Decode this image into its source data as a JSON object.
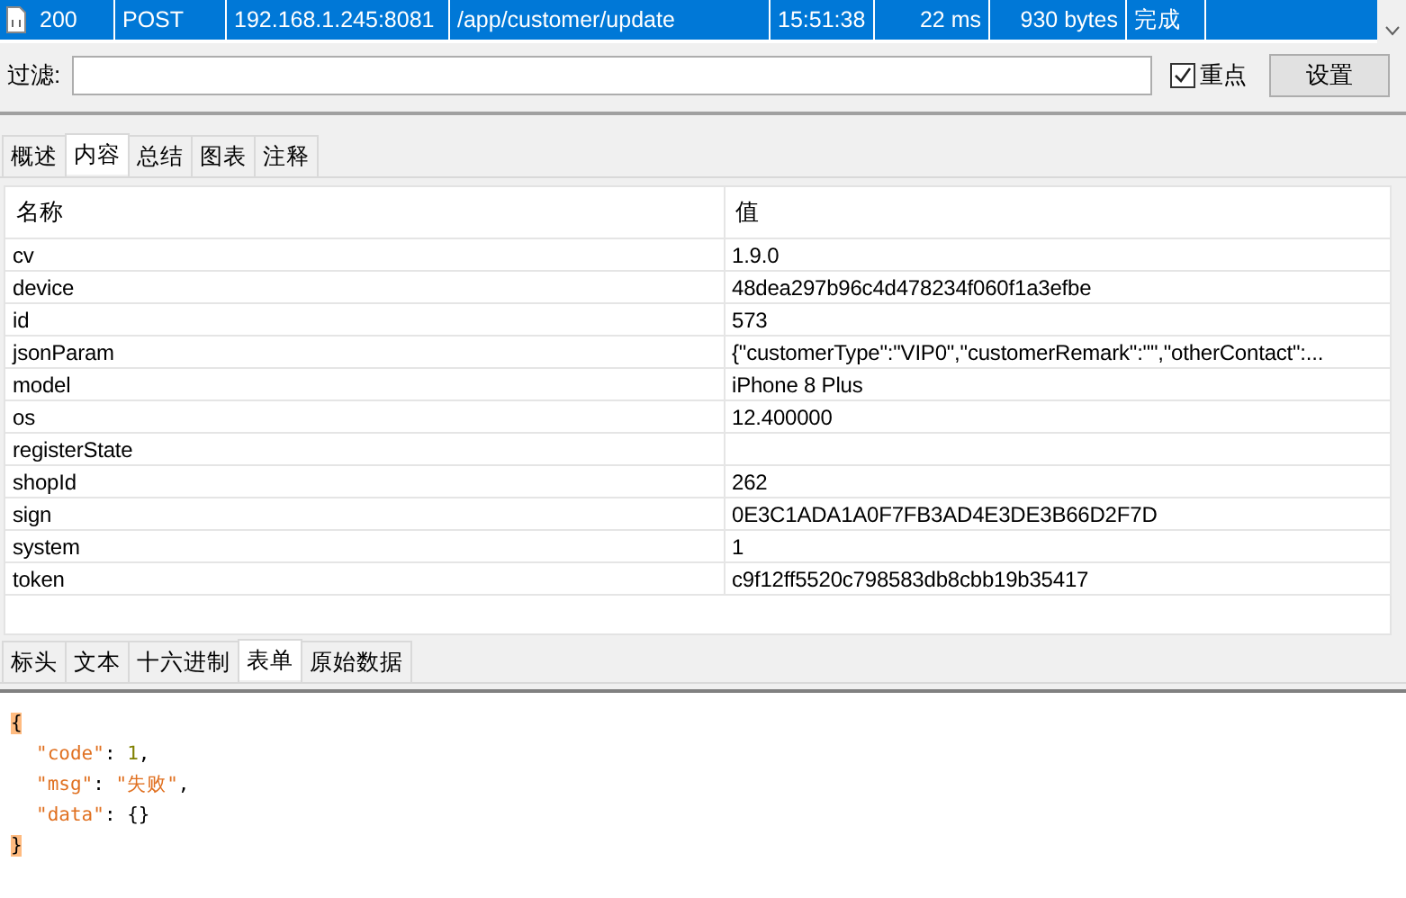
{
  "session_row": {
    "selected": true,
    "cells": [
      "200",
      "POST",
      "192.168.1.245:8081",
      "/app/customer/update",
      "15:51:38",
      "22 ms",
      "930 bytes",
      "完成"
    ]
  },
  "filter": {
    "label": "过滤:"
  },
  "focus_checkbox": {
    "label": "重点",
    "checked": true
  },
  "settings_button": "设置",
  "top_tabs": [
    {
      "label": "概述",
      "selected": false
    },
    {
      "label": "内容",
      "selected": true
    },
    {
      "label": "总结",
      "selected": false
    },
    {
      "label": "图表",
      "selected": false
    },
    {
      "label": "注释",
      "selected": false
    }
  ],
  "table": {
    "columns": [
      "名称",
      "值"
    ],
    "rows": [
      [
        "cv",
        "1.9.0"
      ],
      [
        "device",
        "48dea297b96c4d478234f060f1a3efbe"
      ],
      [
        "id",
        "573"
      ],
      [
        "jsonParam",
        "{\"customerType\":\"VIP0\",\"customerRemark\":\"\",\"otherContact\":..."
      ],
      [
        "model",
        "iPhone 8 Plus"
      ],
      [
        "os",
        "12.400000"
      ],
      [
        "registerState",
        ""
      ],
      [
        "shopId",
        "262"
      ],
      [
        "sign",
        "0E3C1ADA1A0F7FB3AD4E3DE3B66D2F7D"
      ],
      [
        "system",
        "1"
      ],
      [
        "token",
        "c9f12ff5520c798583db8cbb19b35417"
      ]
    ]
  },
  "bottom_tabs": [
    {
      "label": "标头",
      "selected": false
    },
    {
      "label": "文本",
      "selected": false
    },
    {
      "label": "十六进制",
      "selected": false
    },
    {
      "label": "表单",
      "selected": true
    },
    {
      "label": "原始数据",
      "selected": false
    }
  ],
  "response_lines": [
    [
      {
        "kind": "brace",
        "text": "{"
      }
    ],
    [
      {
        "kind": "key",
        "text": "\"code\""
      },
      {
        "kind": "punct",
        "text": ": "
      },
      {
        "kind": "number",
        "text": "1"
      },
      {
        "kind": "punct",
        "text": ","
      }
    ],
    [
      {
        "kind": "key",
        "text": "\"msg\""
      },
      {
        "kind": "punct",
        "text": ": "
      },
      {
        "kind": "string",
        "text": "\"失败\""
      },
      {
        "kind": "punct",
        "text": ","
      }
    ],
    [
      {
        "kind": "key",
        "text": "\"data\""
      },
      {
        "kind": "punct",
        "text": ": "
      },
      {
        "kind": "punct",
        "text": "{}"
      }
    ],
    [
      {
        "kind": "brace",
        "text": "}"
      }
    ]
  ]
}
